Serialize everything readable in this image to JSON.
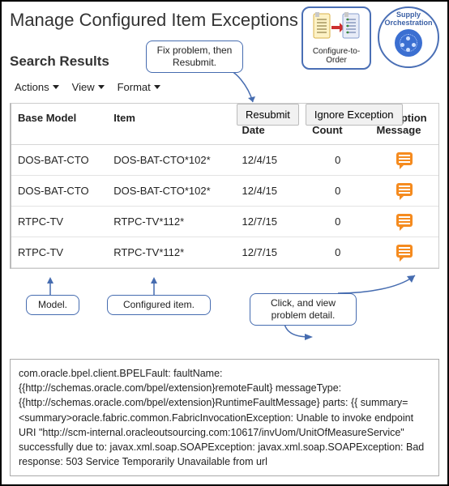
{
  "header": {
    "title": "Manage Configured Item Exceptions",
    "section": "Search Results",
    "badges": {
      "cto_label": "Configure-to-Order",
      "supply_label": "Supply Orchestration"
    }
  },
  "callouts": {
    "fix": "Fix problem, then Resubmit.",
    "model": "Model.",
    "configured_item": "Configured item.",
    "detail": "Click, and view problem detail."
  },
  "toolbar": {
    "menus": [
      "Actions",
      "View",
      "Format"
    ],
    "buttons": {
      "resubmit": "Resubmit",
      "ignore": "Ignore Exception"
    }
  },
  "table": {
    "columns": [
      "Base Model",
      "Item",
      "Exception Date",
      "Resubmit Count",
      "Exception Message"
    ],
    "rows": [
      {
        "base_model": "DOS-BAT-CTO",
        "item": "DOS-BAT-CTO*102*",
        "date": "12/4/15",
        "count": "0"
      },
      {
        "base_model": "DOS-BAT-CTO",
        "item": "DOS-BAT-CTO*102*",
        "date": "12/4/15",
        "count": "0"
      },
      {
        "base_model": "RTPC-TV",
        "item": "RTPC-TV*112*",
        "date": "12/7/15",
        "count": "0"
      },
      {
        "base_model": "RTPC-TV",
        "item": "RTPC-TV*112*",
        "date": "12/7/15",
        "count": "0"
      }
    ]
  },
  "exception_detail": "com.oracle.bpel.client.BPELFault: faultName: {{http://schemas.oracle.com/bpel/extension}remoteFault} messageType: {{http://schemas.oracle.com/bpel/extension}RuntimeFaultMessage} parts: {{ summary=<summary>oracle.fabric.common.FabricInvocationException: Unable to invoke endpoint URI \"http://scm-internal.oracleoutsourcing.com:10617/invUom/UnitOfMeasureService\" successfully due to: javax.xml.soap.SOAPException: javax.xml.soap.SOAPException: Bad response: 503 Service Temporarily Unavailable from url"
}
